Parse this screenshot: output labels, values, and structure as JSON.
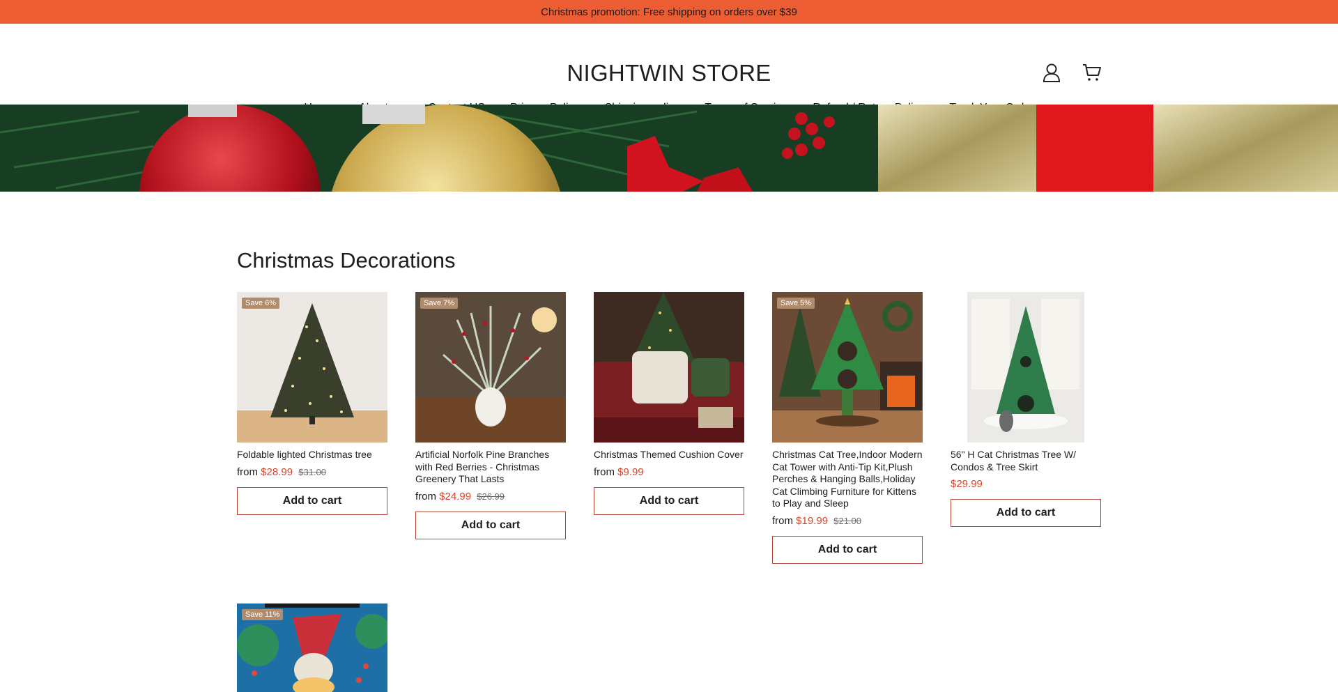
{
  "promo": {
    "text": "Christmas promotion: Free shipping on orders over $39"
  },
  "store": {
    "name": "NIGHTWIN STORE"
  },
  "icons": {
    "account": "user-icon",
    "cart": "cart-icon"
  },
  "nav": {
    "items": [
      "Home",
      "About us",
      "Contact US",
      "Privacy Policy",
      "Shipping policy",
      "Terms of Service",
      "Refund / Return Policy",
      "Track Your Order"
    ]
  },
  "section": {
    "title": "Christmas Decorations"
  },
  "colors": {
    "promo_bg": "#ec5d33",
    "sale_price": "#d9432a",
    "badge_bg": "#b08b6c"
  },
  "products": [
    {
      "badge": "Save 6%",
      "title": "Foldable lighted Christmas tree",
      "from": "from",
      "price": "$28.99",
      "old_price": "$31.00",
      "button": "Add to cart"
    },
    {
      "badge": "Save 7%",
      "title": "Artificial Norfolk Pine Branches with Red Berries - Christmas Greenery That Lasts",
      "from": "from",
      "price": "$24.99",
      "old_price": "$26.99",
      "button": "Add to cart"
    },
    {
      "badge": "",
      "title": "Christmas Themed Cushion Cover",
      "from": "from",
      "price": "$9.99",
      "old_price": "",
      "button": "Add to cart"
    },
    {
      "badge": "Save 5%",
      "title": "Christmas Cat Tree,Indoor Modern Cat Tower with Anti-Tip Kit,Plush Perches & Hanging Balls,Holiday Cat Climbing Furniture for Kittens to Play and Sleep",
      "from": "from",
      "price": "$19.99",
      "old_price": "$21.00",
      "button": "Add to cart"
    },
    {
      "badge": "",
      "title": "56\" H Cat Christmas Tree W/ Condos & Tree Skirt",
      "from": "",
      "price": "$29.99",
      "old_price": "",
      "button": "Add to cart"
    },
    {
      "badge": "Save 11%",
      "title": "",
      "from": "",
      "price": "",
      "old_price": "",
      "button": ""
    }
  ]
}
